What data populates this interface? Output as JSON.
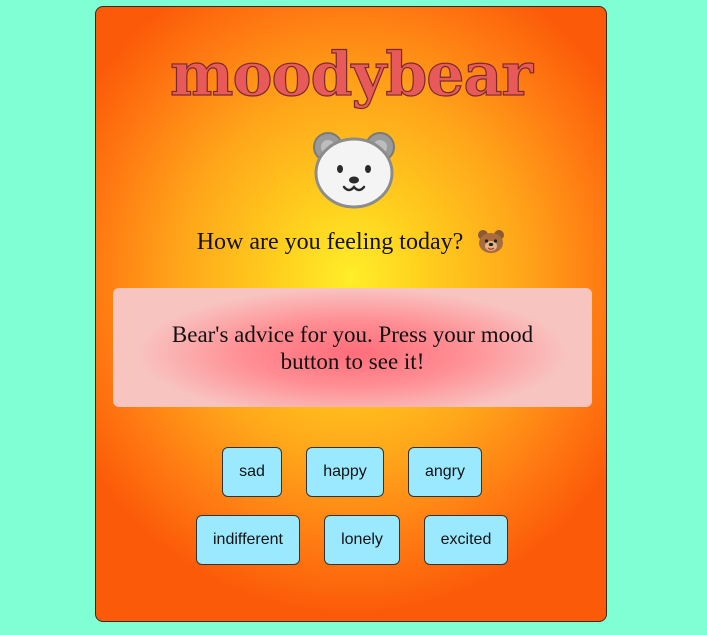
{
  "app": {
    "title": "moodybear",
    "question": "How are you feeling today?",
    "bear_face_icon": "polar-bear-face-icon",
    "bear_mini_icon": "brown-bear-face-icon"
  },
  "advice": {
    "text": "Bear's advice for you. Press your mood button to see it!"
  },
  "moods": {
    "row1": [
      "sad",
      "happy",
      "angry"
    ],
    "row2": [
      "indifferent",
      "lonely",
      "excited"
    ]
  },
  "colors": {
    "background": "#80ffd4",
    "title": "#e85a5a",
    "button": "#9be9ff",
    "advice_center": "#ff6d7a"
  }
}
